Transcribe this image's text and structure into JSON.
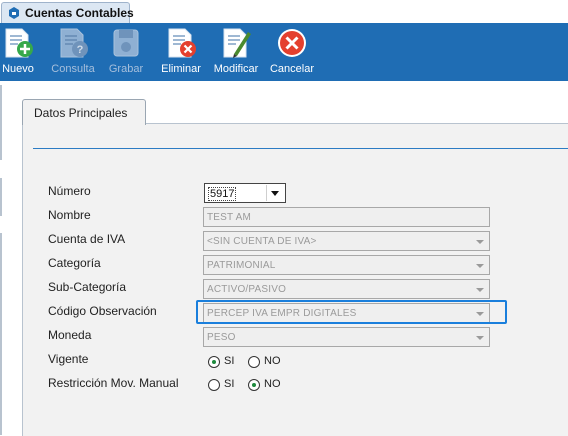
{
  "window": {
    "tab_title": "Cuentas Contables"
  },
  "toolbar": {
    "buttons": [
      {
        "label": "Nuevo",
        "icon": "new-document-icon",
        "enabled": true
      },
      {
        "label": "Consulta",
        "icon": "query-document-icon",
        "enabled": false
      },
      {
        "label": "Grabar",
        "icon": "save-disk-icon",
        "enabled": false
      },
      {
        "label": "Eliminar",
        "icon": "delete-document-icon",
        "enabled": true
      },
      {
        "label": "Modificar",
        "icon": "edit-document-icon",
        "enabled": true
      },
      {
        "label": "Cancelar",
        "icon": "cancel-icon",
        "enabled": true
      }
    ]
  },
  "tabs": {
    "datos": "Datos Principales"
  },
  "form": {
    "numero": {
      "label": "Número",
      "value": "5917"
    },
    "nombre": {
      "label": "Nombre",
      "value": "TEST AM"
    },
    "cuenta_iva": {
      "label": "Cuenta de IVA",
      "value": "<SIN CUENTA DE IVA>"
    },
    "categoria": {
      "label": "Categoría",
      "value": "PATRIMONIAL"
    },
    "subcategoria": {
      "label": "Sub-Categoría",
      "value": "ACTIVO/PASIVO"
    },
    "codigo_obs": {
      "label": "Código Observación",
      "value": "PERCEP IVA EMPR DIGITALES"
    },
    "moneda": {
      "label": "Moneda",
      "value": "PESO"
    },
    "vigente": {
      "label": "Vigente",
      "si": "SI",
      "no": "NO",
      "selected": "SI"
    },
    "restriccion": {
      "label": "Restricción Mov. Manual",
      "si": "SI",
      "no": "NO",
      "selected": "NO"
    }
  },
  "colors": {
    "toolbar": "#1f6db4",
    "highlight": "#1a7fdc",
    "radio_dot": "#1d8a3d",
    "cancel": "#e4402e"
  }
}
